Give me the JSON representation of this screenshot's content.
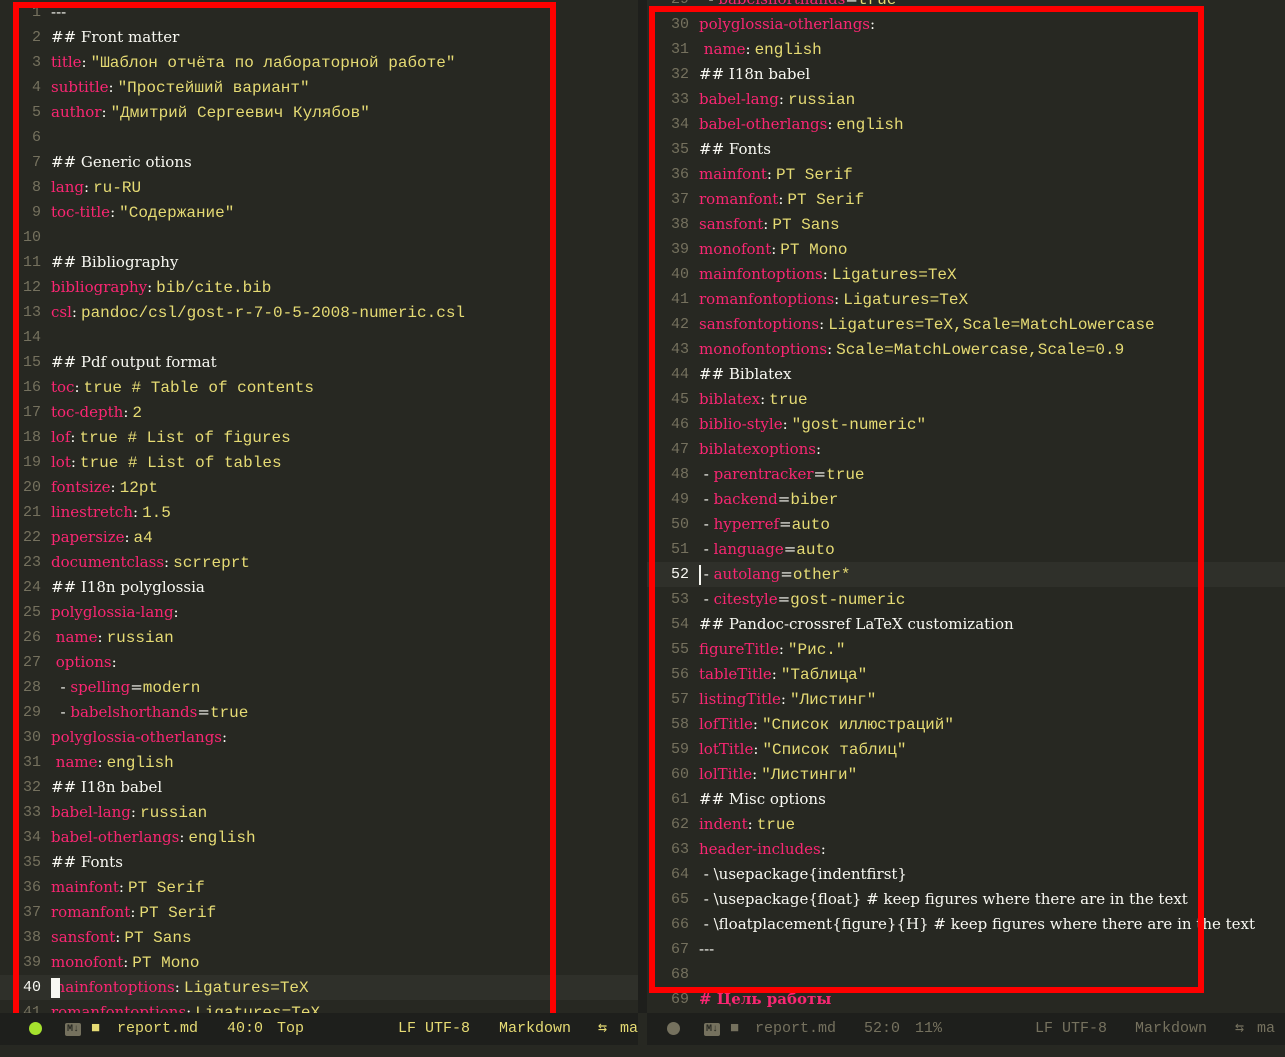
{
  "colors": {
    "background": "#272822",
    "key": "#f92672",
    "string": "#e6db74",
    "text": "#f8f8f2",
    "line_number": "#75715e",
    "highlight_box": "#ff0000"
  },
  "left_pane": {
    "lines": [
      {
        "n": "1",
        "p": "---"
      },
      {
        "n": "2",
        "h": "## Front matter"
      },
      {
        "n": "3",
        "k": "title",
        "v": "\"Шаблон отчёта по лабораторной работе\""
      },
      {
        "n": "4",
        "k": "subtitle",
        "v": "\"Простейший вариант\""
      },
      {
        "n": "5",
        "k": "author",
        "v": "\"Дмитрий Сергеевич Кулябов\""
      },
      {
        "n": "6"
      },
      {
        "n": "7",
        "h": "## Generic otions"
      },
      {
        "n": "8",
        "k": "lang",
        "v": "ru-RU"
      },
      {
        "n": "9",
        "k": "toc-title",
        "v": "\"Содержание\""
      },
      {
        "n": "10"
      },
      {
        "n": "11",
        "h": "## Bibliography"
      },
      {
        "n": "12",
        "k": "bibliography",
        "v": "bib/cite.bib"
      },
      {
        "n": "13",
        "k": "csl",
        "v": "pandoc/csl/gost-r-7-0-5-2008-numeric.csl"
      },
      {
        "n": "14"
      },
      {
        "n": "15",
        "h": "## Pdf output format"
      },
      {
        "n": "16",
        "k": "toc",
        "v": "true # Table of contents"
      },
      {
        "n": "17",
        "k": "toc-depth",
        "v": "2"
      },
      {
        "n": "18",
        "k": "lof",
        "v": "true # List of figures"
      },
      {
        "n": "19",
        "k": "lot",
        "v": "true # List of tables"
      },
      {
        "n": "20",
        "k": "fontsize",
        "v": "12pt"
      },
      {
        "n": "21",
        "k": "linestretch",
        "v": "1.5"
      },
      {
        "n": "22",
        "k": "papersize",
        "v": "a4"
      },
      {
        "n": "23",
        "k": "documentclass",
        "v": "scrreprt"
      },
      {
        "n": "24",
        "h": "## I18n polyglossia"
      },
      {
        "n": "25",
        "k": "polyglossia-lang",
        "c": ":"
      },
      {
        "n": "26",
        "i": " ",
        "k": "name",
        "v": "russian"
      },
      {
        "n": "27",
        "i": " ",
        "k": "options",
        "c": ":"
      },
      {
        "n": "28",
        "i": "  - ",
        "k": "spelling",
        "e": "=",
        "v": "modern"
      },
      {
        "n": "29",
        "i": "  - ",
        "k": "babelshorthands",
        "e": "=",
        "v": "true"
      },
      {
        "n": "30",
        "k": "polyglossia-otherlangs",
        "c": ":"
      },
      {
        "n": "31",
        "i": " ",
        "k": "name",
        "v": "english"
      },
      {
        "n": "32",
        "h": "## I18n babel"
      },
      {
        "n": "33",
        "k": "babel-lang",
        "v": "russian"
      },
      {
        "n": "34",
        "k": "babel-otherlangs",
        "v": "english"
      },
      {
        "n": "35",
        "h": "## Fonts"
      },
      {
        "n": "36",
        "k": "mainfont",
        "v": "PT Serif"
      },
      {
        "n": "37",
        "k": "romanfont",
        "v": "PT Serif"
      },
      {
        "n": "38",
        "k": "sansfont",
        "v": "PT Sans"
      },
      {
        "n": "39",
        "k": "monofont",
        "v": "PT Mono"
      },
      {
        "n": "40",
        "k": "mainfontoptions",
        "v": "Ligatures=TeX",
        "cur": true
      },
      {
        "n": "41",
        "k": "romanfontoptions",
        "v": "Ligatures=TeX"
      }
    ],
    "status": {
      "mode_badge": "M↓",
      "filename": "report.md",
      "position": "40:0",
      "scroll": "Top",
      "encoding": "LF UTF-8",
      "major_mode": "Markdown",
      "vcs": "ma"
    }
  },
  "right_pane": {
    "lines": [
      {
        "n": "29",
        "i": "  - ",
        "k": "babelshorthands",
        "e": "=",
        "v": "true"
      },
      {
        "n": "30",
        "k": "polyglossia-otherlangs",
        "c": ":"
      },
      {
        "n": "31",
        "i": " ",
        "k": "name",
        "v": "english"
      },
      {
        "n": "32",
        "h": "## I18n babel"
      },
      {
        "n": "33",
        "k": "babel-lang",
        "v": "russian"
      },
      {
        "n": "34",
        "k": "babel-otherlangs",
        "v": "english"
      },
      {
        "n": "35",
        "h": "## Fonts"
      },
      {
        "n": "36",
        "k": "mainfont",
        "v": "PT Serif"
      },
      {
        "n": "37",
        "k": "romanfont",
        "v": "PT Serif"
      },
      {
        "n": "38",
        "k": "sansfont",
        "v": "PT Sans"
      },
      {
        "n": "39",
        "k": "monofont",
        "v": "PT Mono"
      },
      {
        "n": "40",
        "k": "mainfontoptions",
        "v": "Ligatures=TeX"
      },
      {
        "n": "41",
        "k": "romanfontoptions",
        "v": "Ligatures=TeX"
      },
      {
        "n": "42",
        "k": "sansfontoptions",
        "v": "Ligatures=TeX,Scale=MatchLowercase"
      },
      {
        "n": "43",
        "k": "monofontoptions",
        "v": "Scale=MatchLowercase,Scale=0.9"
      },
      {
        "n": "44",
        "h": "## Biblatex"
      },
      {
        "n": "45",
        "k": "biblatex",
        "v": "true"
      },
      {
        "n": "46",
        "k": "biblio-style",
        "v": "\"gost-numeric\""
      },
      {
        "n": "47",
        "k": "biblatexoptions",
        "c": ":"
      },
      {
        "n": "48",
        "i": " - ",
        "k": "parentracker",
        "e": "=",
        "v": "true"
      },
      {
        "n": "49",
        "i": " - ",
        "k": "backend",
        "e": "=",
        "v": "biber"
      },
      {
        "n": "50",
        "i": " - ",
        "k": "hyperref",
        "e": "=",
        "v": "auto"
      },
      {
        "n": "51",
        "i": " - ",
        "k": "language",
        "e": "=",
        "v": "auto"
      },
      {
        "n": "52",
        "i": " - ",
        "k": "autolang",
        "e": "=",
        "v": "other*",
        "cur": true
      },
      {
        "n": "53",
        "i": " - ",
        "k": "citestyle",
        "e": "=",
        "v": "gost-numeric"
      },
      {
        "n": "54",
        "h": "## Pandoc-crossref LaTeX customization"
      },
      {
        "n": "55",
        "k": "figureTitle",
        "v": "\"Рис.\""
      },
      {
        "n": "56",
        "k": "tableTitle",
        "v": "\"Таблица\""
      },
      {
        "n": "57",
        "k": "listingTitle",
        "v": "\"Листинг\""
      },
      {
        "n": "58",
        "k": "lofTitle",
        "v": "\"Список иллюстраций\""
      },
      {
        "n": "59",
        "k": "lotTitle",
        "v": "\"Список таблиц\""
      },
      {
        "n": "60",
        "k": "lolTitle",
        "v": "\"Листинги\""
      },
      {
        "n": "61",
        "h": "## Misc options"
      },
      {
        "n": "62",
        "k": "indent",
        "v": "true"
      },
      {
        "n": "63",
        "k": "header-includes",
        "c": ":"
      },
      {
        "n": "64",
        "p": " - \\usepackage{indentfirst}"
      },
      {
        "n": "65",
        "p": " - \\usepackage{float} # keep figures where there are in the text"
      },
      {
        "n": "66",
        "p": " - \\floatplacement{figure}{H} # keep figures where there are in the text"
      },
      {
        "n": "67",
        "p": "---"
      },
      {
        "n": "68"
      },
      {
        "n": "69",
        "hw": "# Цель работы"
      }
    ],
    "status": {
      "mode_badge": "M↓",
      "filename": "report.md",
      "position": "52:0",
      "scroll": "11%",
      "encoding": "LF UTF-8",
      "major_mode": "Markdown",
      "vcs": "ma"
    }
  }
}
